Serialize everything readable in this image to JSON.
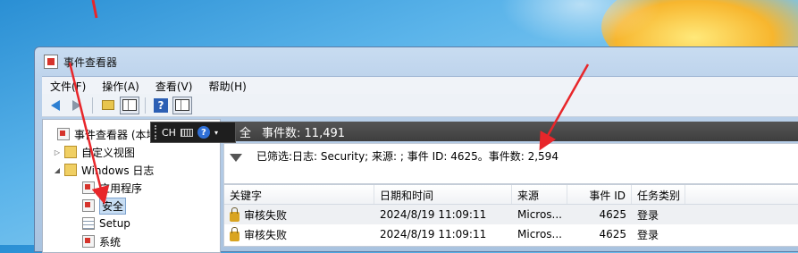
{
  "window": {
    "title": "事件查看器"
  },
  "menu": [
    "文件(F)",
    "操作(A)",
    "查看(V)",
    "帮助(H)"
  ],
  "tree": [
    {
      "label": "事件查看器 (本地",
      "icon": "event-viewer-icon",
      "expander": ""
    },
    {
      "label": "自定义视图",
      "icon": "folder-icon",
      "expander": "▷"
    },
    {
      "label": "Windows 日志",
      "icon": "folder-icon",
      "expander": "◢"
    },
    {
      "label": "应用程序",
      "icon": "log-icon",
      "expander": ""
    },
    {
      "label": "安全",
      "icon": "log-icon",
      "expander": ""
    },
    {
      "label": "Setup",
      "icon": "sheet-icon",
      "expander": ""
    },
    {
      "label": "系统",
      "icon": "log-icon",
      "expander": ""
    }
  ],
  "ime": {
    "lang": "CH",
    "help": "?"
  },
  "header": {
    "section": "全",
    "count_label": "事件数: 11,491"
  },
  "filter": {
    "text": "已筛选:日志: Security; 来源: ; 事件 ID: 4625。事件数: 2,594"
  },
  "table": {
    "columns": [
      "关键字",
      "日期和时间",
      "来源",
      "事件 ID",
      "任务类别"
    ],
    "rows": [
      [
        "审核失败",
        "2024/8/19 11:09:11",
        "Micros...",
        "4625",
        "登录"
      ],
      [
        "审核失败",
        "2024/8/19 11:09:11",
        "Micros...",
        "4625",
        "登录"
      ]
    ]
  },
  "colors": {
    "annotation": "#e8262a",
    "selection": "#c7ddf3",
    "header_bg": "#4a4a4a"
  }
}
